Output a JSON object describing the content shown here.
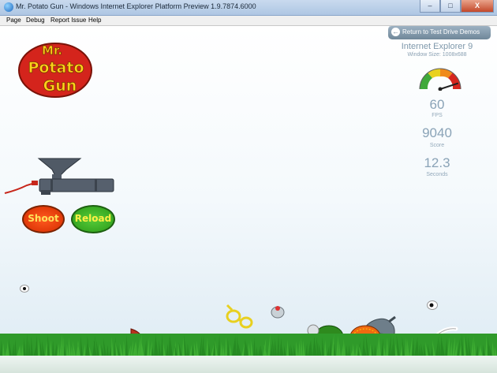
{
  "window": {
    "title": "Mr. Potato Gun - Windows Internet Explorer Platform Preview 1.9.7874.6000",
    "minimize": "–",
    "maximize": "□",
    "close": "X"
  },
  "menu": {
    "items": [
      {
        "label": "Page"
      },
      {
        "label": "Debug"
      },
      {
        "label": "Report Issue"
      },
      {
        "label": "Help"
      }
    ]
  },
  "header": {
    "return_label": "Return to Test Drive Demos"
  },
  "logo": {
    "line1": "Mr.",
    "line2": "Potato",
    "line3": "Gun"
  },
  "info": {
    "browser": "Internet Explorer 9",
    "window_size": "Window Size: 1008x688"
  },
  "gauge": {
    "level_fraction": 0.9,
    "colors": {
      "green": "#3fa93a",
      "yellow": "#e9d21e",
      "orange": "#f08a1b",
      "red": "#d7261e"
    }
  },
  "stats": {
    "fps_value": "60",
    "fps_label": "FPS",
    "score_value": "9040",
    "score_label": "Score",
    "seconds_value": "12.3",
    "seconds_label": "Seconds"
  },
  "controls": {
    "shoot_label": "Shoot",
    "reload_label": "Reload"
  },
  "colors": {
    "accent": "#8aa3b7",
    "shoot": "#e23a0a",
    "reload": "#3fb227",
    "logo_red": "#d4241c",
    "logo_yellow": "#ffd21a"
  }
}
